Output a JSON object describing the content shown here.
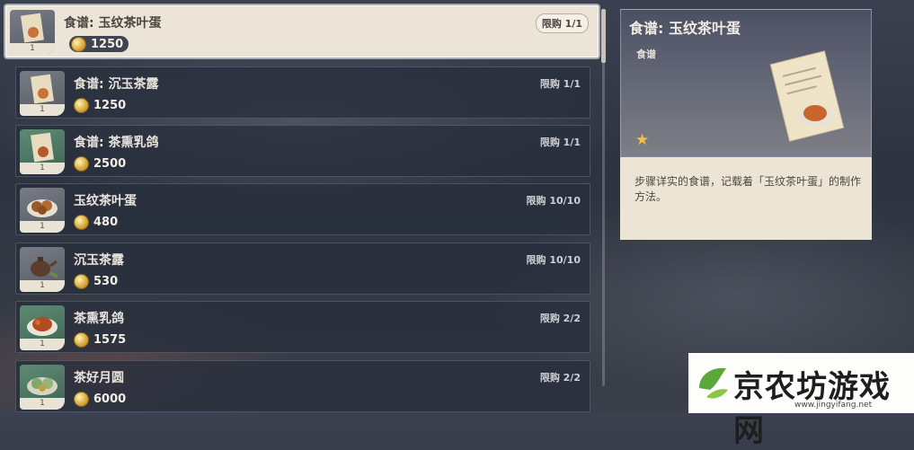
{
  "items": [
    {
      "name": "食谱: 玉纹茶叶蛋",
      "price": "1250",
      "limit": "限购 1/1",
      "count": "1",
      "icon": "recipe-scroll-icon",
      "selected": true
    },
    {
      "name": "食谱: 沉玉茶露",
      "price": "1250",
      "limit": "限购 1/1",
      "count": "1",
      "icon": "recipe-scroll-icon"
    },
    {
      "name": "食谱: 茶熏乳鸽",
      "price": "2500",
      "limit": "限购 1/1",
      "count": "1",
      "icon": "recipe-scroll-icon"
    },
    {
      "name": "玉纹茶叶蛋",
      "price": "480",
      "limit": "限购 10/10",
      "count": "1",
      "icon": "tea-egg-icon"
    },
    {
      "name": "沉玉茶露",
      "price": "530",
      "limit": "限购 10/10",
      "count": "1",
      "icon": "teapot-icon"
    },
    {
      "name": "茶熏乳鸽",
      "price": "1575",
      "limit": "限购 2/2",
      "count": "1",
      "icon": "roast-pigeon-icon"
    },
    {
      "name": "茶好月圆",
      "price": "6000",
      "limit": "限购 2/2",
      "count": "1",
      "icon": "mooncake-icon"
    }
  ],
  "detail": {
    "title": "食谱: 玉纹茶叶蛋",
    "type": "食谱",
    "rarity_icon": "star-icon",
    "description": "步骤详实的食谱，记载着「玉纹茶叶蛋」的制作方法。"
  },
  "watermark": {
    "text": "京农坊游戏网",
    "url": "www.jingyifang.net"
  },
  "colors": {
    "selected_bg": "#ece5d7",
    "row_bg": "#282e3c",
    "coin": "#d6a63a",
    "star": "#f3c244"
  }
}
